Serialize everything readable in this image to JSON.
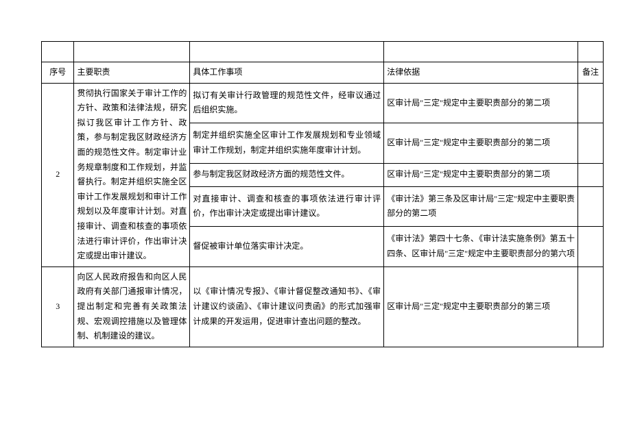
{
  "headers": {
    "seq": "序号",
    "duty": "主要职责",
    "work": "具体工作事项",
    "law": "法律依据",
    "note": "备注"
  },
  "rows": [
    {
      "seq": "2",
      "duty": "贯彻执行国家关于审计工作的方针、政策和法律法规，研究拟订我区审计工作方针、政策，参与制定我区财政经济方面的规范性文件。制定审计业务规章制度和工作规划，并监督执行。制定并组织实施全区审计工作发展规划和审计工作规划以及年度审计计划。对直接审计、调查和核查的事项依法进行审计评价，作出审计决定或提出审计建议。",
      "items": [
        {
          "work": "拟订有关审计行政管理的规范性文件，经审议通过后组织实施。",
          "law": "区审计局\"三定\"规定中主要职责部分的第二项",
          "note": ""
        },
        {
          "work": "制定并组织实施全区审计工作发展规划和专业领域审计工作规划，制定并组织实施年度审计计划。",
          "law": "区审计局\"三定\"规定中主要职责部分的第二项",
          "note": ""
        },
        {
          "work": "参与制定我区财政经济方面的规范性文件。",
          "law": "区审计局\"三定\"规定中主要职责部分的第二项",
          "note": ""
        },
        {
          "work": "对直接审计、调查和核查的事项依法进行审计评价，作出审计决定或提出审计建议。",
          "law": "《审计法》第三条及区审计局\"三定\"规定中主要职责部分的第二项",
          "note": ""
        },
        {
          "work": "督促被审计单位落实审计决定。",
          "law": "《审计法》第四十七条、《审计法实施条例》第五十四条、区审计局\"三定\"规定中主要职责部分的第六项",
          "note": ""
        }
      ]
    },
    {
      "seq": "3",
      "duty": "向区人民政府报告和向区人民政府有关部门通报审计情况，提出制定和完善有关政策法规、宏观调控措施以及管理体制、机制建设的建议。",
      "items": [
        {
          "work": "以《审计情况专报》、《审计督促整改通知书》、《审计建议约谈函》、《审计建议问责函》的形式加强审计成果的开发运用，促进审计查出问题的整改。",
          "law": "区审计局\"三定\"规定中主要职责部分的第三项",
          "note": ""
        }
      ]
    }
  ]
}
